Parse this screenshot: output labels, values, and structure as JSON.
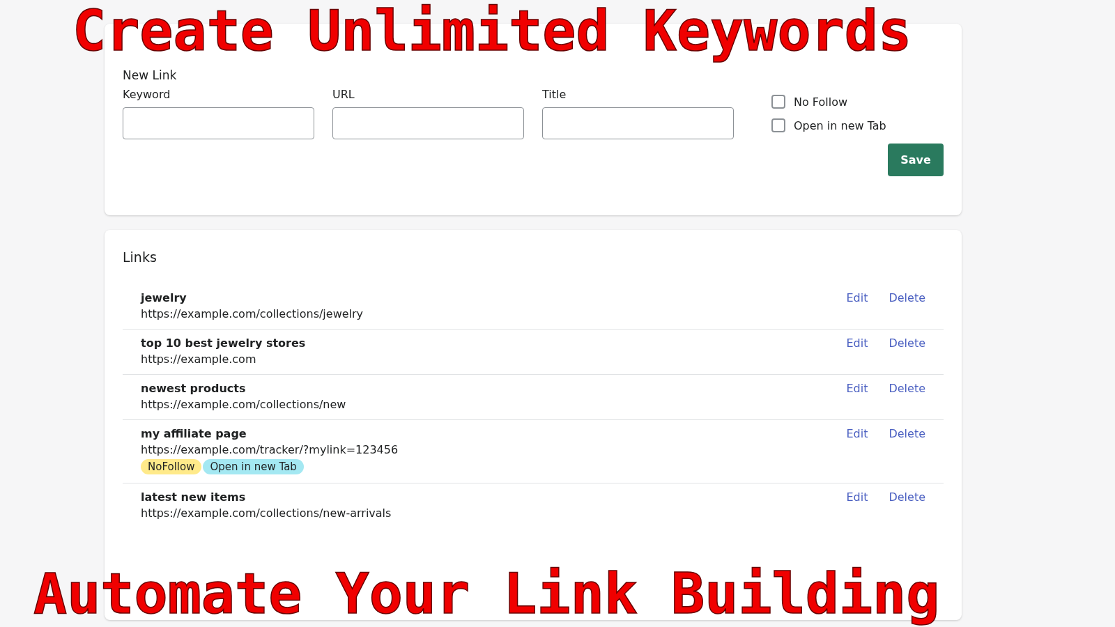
{
  "headline_top": "Create Unlimited Keywords",
  "headline_bottom": "Automate Your Link Building",
  "new_link": {
    "title": "New Link",
    "fields": [
      {
        "label": "Keyword"
      },
      {
        "label": "URL"
      },
      {
        "label": "Title"
      }
    ],
    "options": [
      {
        "label": "No Follow",
        "checked": false
      },
      {
        "label": "Open in new Tab",
        "checked": false
      }
    ],
    "save_button": "Save"
  },
  "links": {
    "title": "Links",
    "rows": [
      {
        "keyword": "jewelry",
        "url": "https://example.com/collections/jewelry",
        "tags": [],
        "actions": [
          "Edit",
          "Delete"
        ]
      },
      {
        "keyword": "top 10 best jewelry stores",
        "url": "https://example.com",
        "tags": [],
        "actions": [
          "Edit",
          "Delete"
        ]
      },
      {
        "keyword": "newest products",
        "url": "https://example.com/collections/new",
        "tags": [],
        "actions": [
          "Edit",
          "Delete"
        ]
      },
      {
        "keyword": "my affiliate page",
        "url": "https://example.com/tracker/?mylink=123456",
        "tags": [
          {
            "label": "NoFollow",
            "color": "#ffea8a"
          },
          {
            "label": "Open in new Tab",
            "color": "#a4e8f2"
          }
        ],
        "actions": [
          "Edit",
          "Delete"
        ]
      },
      {
        "keyword": "latest new items",
        "url": "https://example.com/collections/new-arrivals",
        "tags": [],
        "actions": [
          "Edit",
          "Delete"
        ]
      }
    ]
  }
}
